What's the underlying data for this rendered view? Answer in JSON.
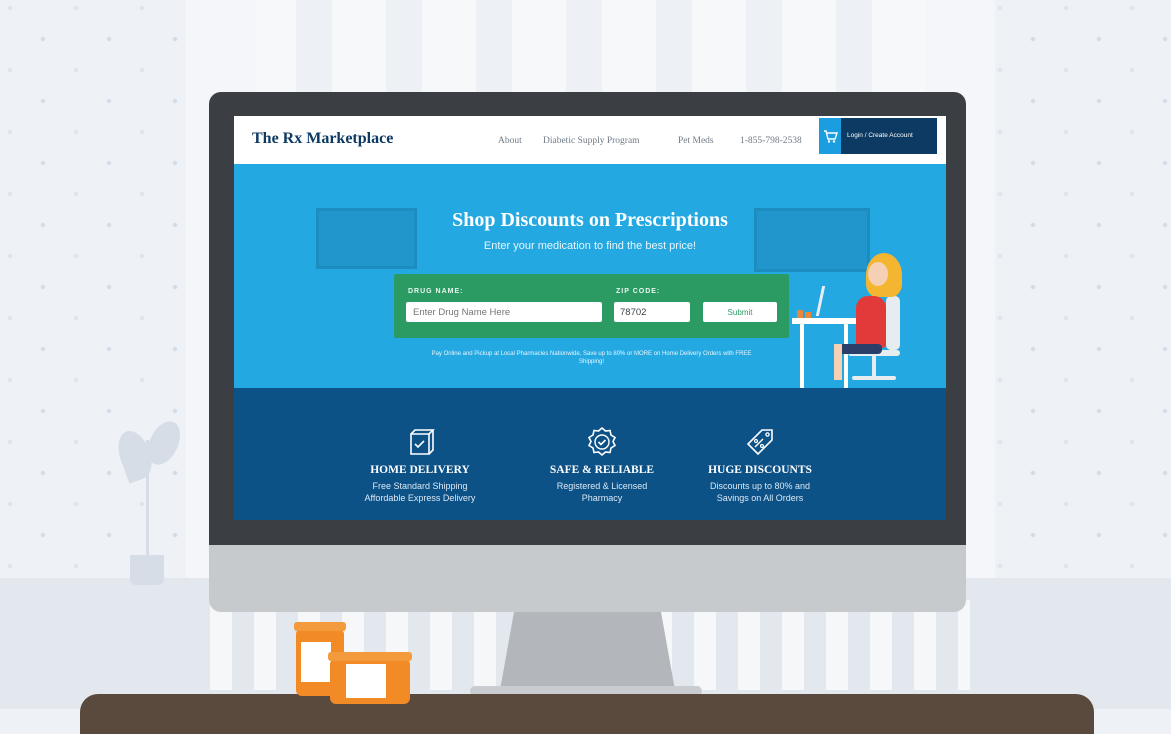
{
  "site": {
    "logo": "The Rx Marketplace",
    "nav": [
      "About",
      "Diabetic Supply Program",
      "Pet Meds",
      "1-855-798-2538"
    ],
    "login_label": "Login / Create Account"
  },
  "hero": {
    "title": "Shop Discounts on Prescriptions",
    "subtitle": "Enter your medication to find the best price!",
    "drug_label": "DRUG NAME:",
    "drug_placeholder": "Enter Drug Name Here",
    "zip_label": "ZIP CODE:",
    "zip_value": "78702",
    "submit_label": "Submit",
    "note": "Pay Online and Pickup at Local Pharmacies Nationwide, Save up to 80% or MORE on Home Delivery Orders with FREE Shipping!"
  },
  "features": [
    {
      "icon": "box-icon",
      "title": "HOME DELIVERY",
      "line1": "Free Standard Shipping",
      "line2": "Affordable Express Delivery"
    },
    {
      "icon": "badge-check-icon",
      "title": "SAFE & RELIABLE",
      "line1": "Registered & Licensed",
      "line2": "Pharmacy"
    },
    {
      "icon": "discount-tag-icon",
      "title": "HUGE DISCOUNTS",
      "line1": "Discounts up to 80% and",
      "line2": "Savings on All Orders"
    }
  ],
  "colors": {
    "brand_navy": "#0d3a63",
    "hero_blue": "#23a8e2",
    "search_green": "#2b9b63",
    "features_blue": "#0d5287",
    "cart_blue": "#1b9ee0"
  }
}
